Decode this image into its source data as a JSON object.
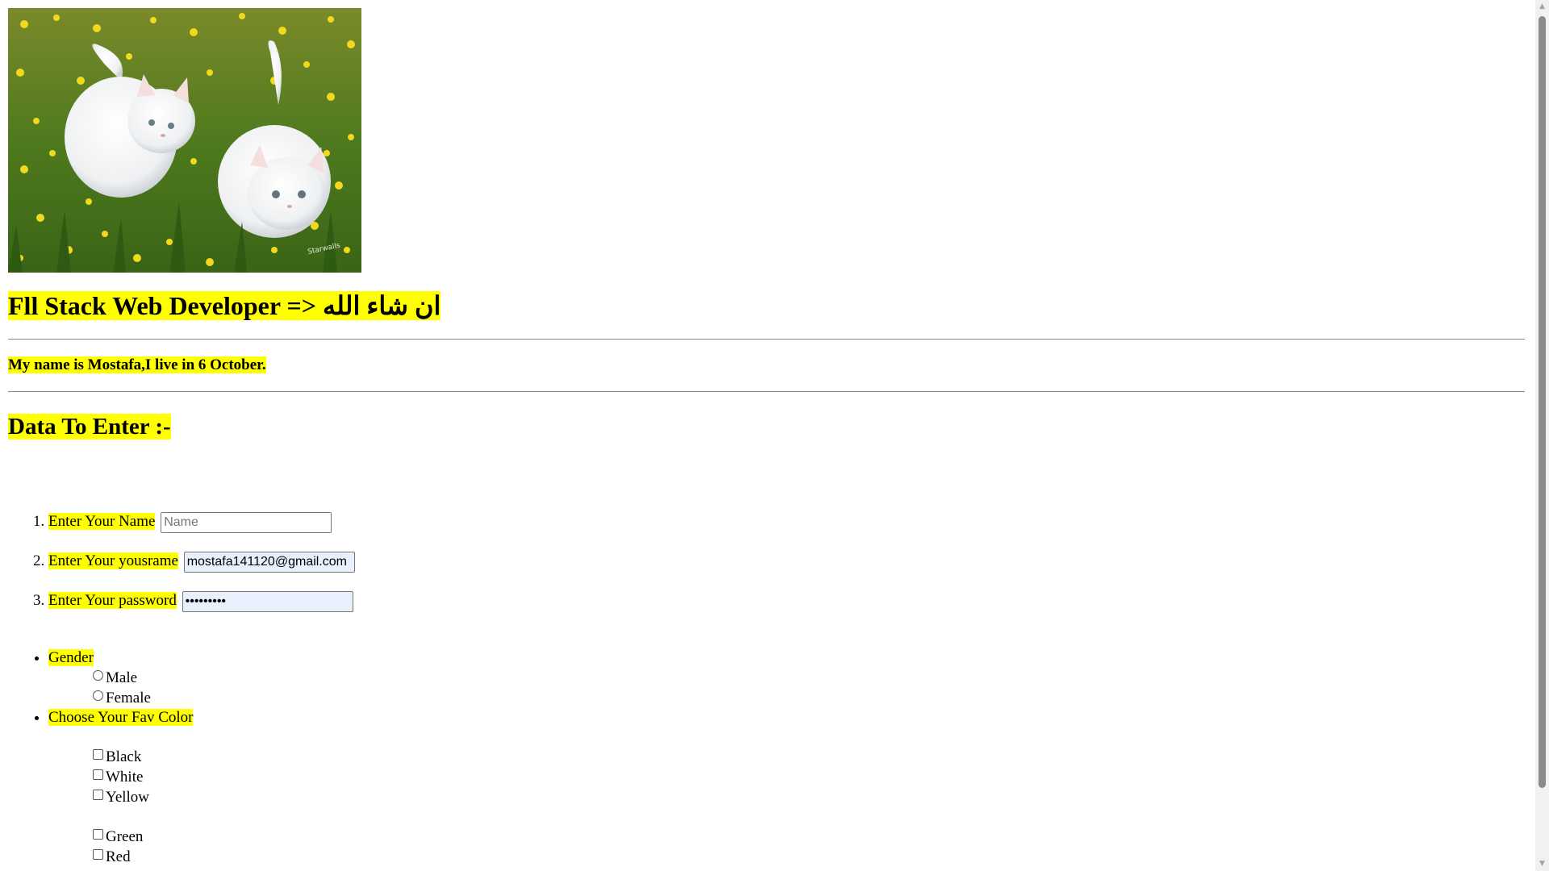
{
  "hero_image": {
    "name": "two white kittens in a yellow flower meadow"
  },
  "header": {
    "title": "Fll Stack Web Developer => ان شاء الله"
  },
  "intro": {
    "text": "My name is Mostafa,I live in 6 October."
  },
  "section": {
    "title": "Data To Enter :-"
  },
  "form": {
    "name_label": "Enter Your Name",
    "name_placeholder": "Name",
    "name_value": "",
    "username_label": "Enter Your yousrame",
    "username_value": "mostafa141120@gmail.com",
    "password_label": "Enter Your password",
    "password_value": "•••••••••"
  },
  "gender": {
    "label": "Gender",
    "options": [
      "Male",
      "Female"
    ]
  },
  "colors": {
    "label": "Choose Your Fav Color",
    "options": [
      "Black",
      "White",
      "Yellow",
      "Green",
      "Red"
    ]
  },
  "style": {
    "highlight": "#ffff00"
  }
}
